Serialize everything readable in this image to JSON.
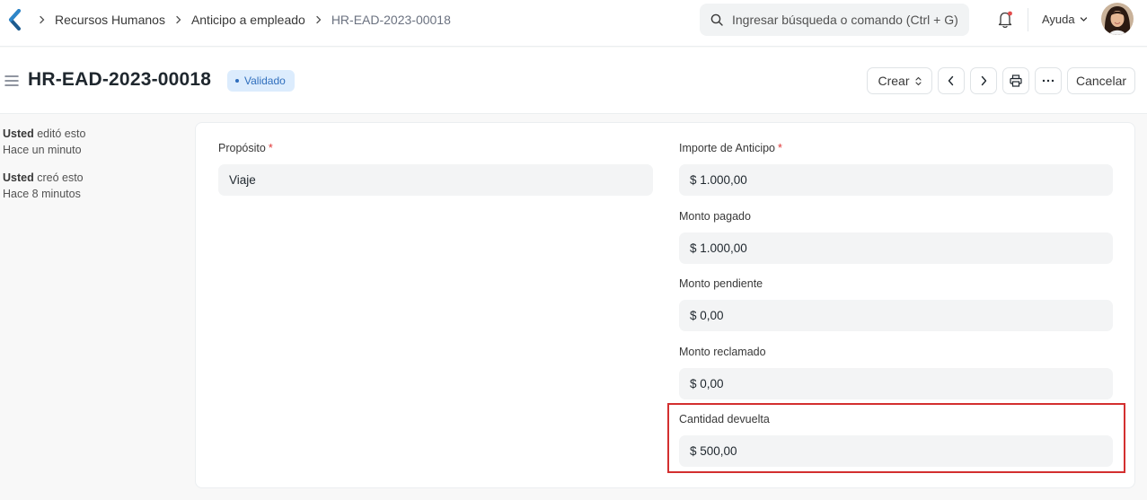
{
  "navbar": {
    "breadcrumbs": [
      "Recursos Humanos",
      "Anticipo a empleado",
      "HR-EAD-2023-00018"
    ],
    "search_placeholder": "Ingresar búsqueda o comando (Ctrl + G)",
    "help_label": "Ayuda",
    "accent_color": "#2f6ebd"
  },
  "page": {
    "title": "HR-EAD-2023-00018",
    "status": "Validado",
    "buttons": {
      "create": "Crear",
      "cancel": "Cancelar"
    }
  },
  "sidebar": {
    "activities": [
      {
        "user": "Usted",
        "action": "editó esto",
        "time": "Hace un minuto"
      },
      {
        "user": "Usted",
        "action": "creó esto",
        "time": "Hace 8 minutos"
      }
    ]
  },
  "form": {
    "proposito": {
      "label": "Propósito",
      "required_mark": "*",
      "value": "Viaje"
    },
    "importe_anticipo": {
      "label": "Importe de Anticipo",
      "required_mark": "*",
      "value": "$ 1.000,00"
    },
    "monto_pagado": {
      "label": "Monto pagado",
      "value": "$ 1.000,00"
    },
    "monto_pendiente": {
      "label": "Monto pendiente",
      "value": "$ 0,00"
    },
    "monto_reclamado": {
      "label": "Monto reclamado",
      "value": "$ 0,00"
    },
    "cantidad_devuelta": {
      "label": "Cantidad devuelta",
      "value": "$ 500,00"
    }
  },
  "highlight_color": "#d32f2f"
}
